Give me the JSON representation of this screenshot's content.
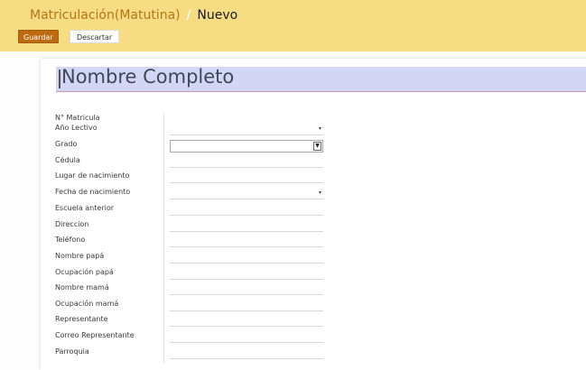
{
  "breadcrumb": {
    "parent": "Matriculación(Matutina)",
    "separator": "/",
    "current": "Nuevo"
  },
  "toolbar": {
    "save_label": "Guardar",
    "discard_label": "Descartar"
  },
  "form": {
    "name_placeholder": "Nombre Completo",
    "labels": {
      "matricula": "N° Matricula",
      "anio_lectivo": "Año Lectivo",
      "grado": "Grado",
      "cedula": "Cédula",
      "lugar_nacimiento": "Lugar de nacimiento",
      "fecha_nacimiento": "Fecha de nacimiento",
      "escuela_anterior": "Escuela anterior",
      "direccion": "Direccion",
      "telefono": "Teléfono",
      "nombre_papa": "Nombre papá",
      "ocupacion_papa": "Ocupación papá",
      "nombre_mama": "Nombre mamá",
      "ocupacion_mama": "Ocupación mamá",
      "representante": "Representante",
      "correo_representante": "Correo Representante",
      "parroquia": "Parroquia"
    },
    "dropdown_arrow": "▾",
    "select_arrow": "▼"
  }
}
